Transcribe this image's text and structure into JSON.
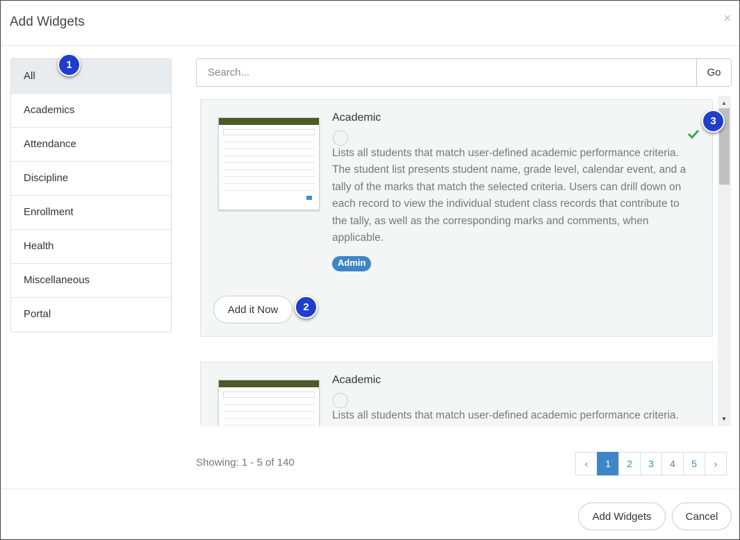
{
  "modal": {
    "title": "Add Widgets",
    "close_icon": "×"
  },
  "categories": [
    {
      "label": "All",
      "active": true
    },
    {
      "label": "Academics"
    },
    {
      "label": "Attendance"
    },
    {
      "label": "Discipline"
    },
    {
      "label": "Enrollment"
    },
    {
      "label": "Health"
    },
    {
      "label": "Miscellaneous"
    },
    {
      "label": "Portal"
    }
  ],
  "search": {
    "placeholder": "Search...",
    "value": "",
    "go_label": "Go"
  },
  "widgets": [
    {
      "title": "Academic",
      "description": "Lists all students that match user-defined academic performance criteria. The student list presents student name, grade level, calendar event, and a tally of the marks that match the selected criteria. Users can drill down on each record to view the individual student class records that contribute to the tally, as well as the corresponding marks and comments, when applicable.",
      "badge": "Admin",
      "add_label": "Add it Now",
      "checked_icon": "check-icon"
    },
    {
      "title": "Academic",
      "description": "Lists all students that match user-defined academic performance criteria."
    }
  ],
  "markers": [
    "1",
    "2",
    "3"
  ],
  "list_footer": {
    "showing_text": "Showing: 1 - 5 of 140",
    "prev": "‹",
    "next": "›",
    "pages": [
      "1",
      "2",
      "3",
      "4",
      "5"
    ],
    "current_page": "1"
  },
  "buttons": {
    "add_widgets": "Add Widgets",
    "cancel": "Cancel"
  },
  "colors": {
    "accent": "#3e86c7",
    "marker": "#1f3ec9",
    "check": "#2eaa4a"
  },
  "scrollbar": {
    "up_icon": "▲",
    "down_icon": "▼"
  }
}
